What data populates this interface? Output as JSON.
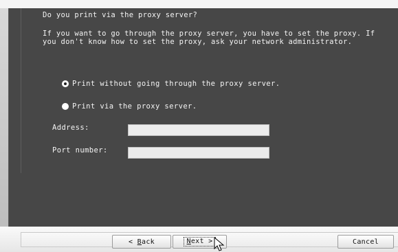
{
  "wizard": {
    "question": "Do you print via the proxy server?",
    "description": "If you want to go through the proxy server, you have to set the proxy. If\nyou don't know how to set the proxy, ask your network administrator."
  },
  "options": [
    {
      "label": "Print without going through the proxy server.",
      "selected": true
    },
    {
      "label": "Print via the proxy server.",
      "selected": false
    }
  ],
  "fields": {
    "address": {
      "label": "Address:",
      "value": ""
    },
    "port": {
      "label": "Port number:",
      "value": ""
    }
  },
  "buttons": {
    "back_prefix": "< ",
    "back_key": "B",
    "back_rest": "ack",
    "next_key": "N",
    "next_rest": "ext >",
    "cancel": "Cancel"
  },
  "icons": {
    "cursor": "mouse-pointer-icon"
  }
}
